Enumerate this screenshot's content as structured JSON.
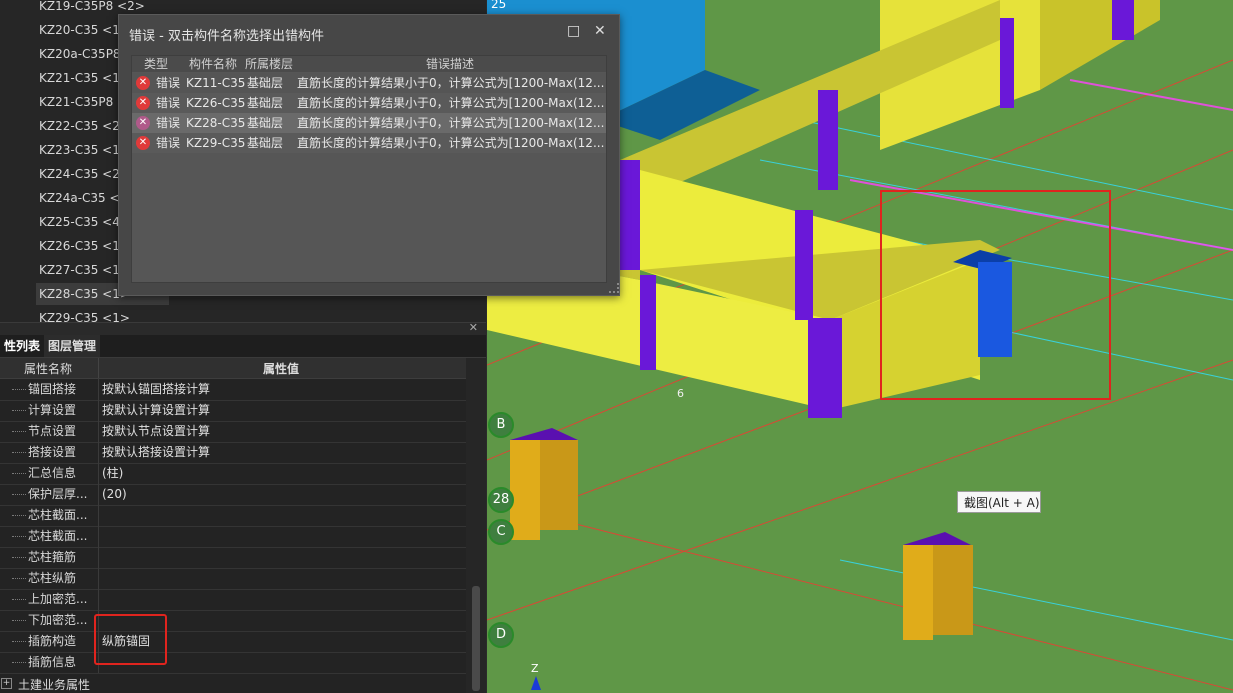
{
  "member_list": [
    {
      "label": "KZ19-C35P8 <2>"
    },
    {
      "label": "KZ20-C35 <1>"
    },
    {
      "label": "KZ20a-C35P8"
    },
    {
      "label": "KZ21-C35 <1"
    },
    {
      "label": "KZ21-C35P8 <"
    },
    {
      "label": "KZ22-C35 <2"
    },
    {
      "label": "KZ23-C35 <1"
    },
    {
      "label": "KZ24-C35 <2"
    },
    {
      "label": "KZ24a-C35 <"
    },
    {
      "label": "KZ25-C35 <4"
    },
    {
      "label": "KZ26-C35 <1"
    },
    {
      "label": "KZ27-C35 <1"
    },
    {
      "label": "KZ28-C35 <1>",
      "selected": true
    },
    {
      "label": "KZ29-C35 <1>"
    }
  ],
  "props_tabs": [
    "性列表",
    "图层管理"
  ],
  "prop_headers": {
    "name": "属性名称",
    "value": "属性值"
  },
  "props": [
    {
      "name": "锚固搭接",
      "value": "按默认锚固搭接计算"
    },
    {
      "name": "计算设置",
      "value": "按默认计算设置计算"
    },
    {
      "name": "节点设置",
      "value": "按默认节点设置计算"
    },
    {
      "name": "搭接设置",
      "value": "按默认搭接设置计算"
    },
    {
      "name": "汇总信息",
      "value": "(柱)"
    },
    {
      "name": "保护层厚...",
      "value": "(20)"
    },
    {
      "name": "芯柱截面...",
      "value": ""
    },
    {
      "name": "芯柱截面...",
      "value": ""
    },
    {
      "name": "芯柱箍筋",
      "value": ""
    },
    {
      "name": "芯柱纵筋",
      "value": ""
    },
    {
      "name": "上加密范...",
      "value": ""
    },
    {
      "name": "下加密范...",
      "value": ""
    },
    {
      "name": "插筋构造",
      "value": "纵筋锚固"
    },
    {
      "name": "插筋信息",
      "value": ""
    }
  ],
  "props_group": {
    "expander": "+",
    "label": "土建业务属性"
  },
  "dialog": {
    "title": "错误 - 双击构件名称选择出错构件",
    "maximize_glyph": "□",
    "close_glyph": "✕",
    "headers": {
      "type": "类型",
      "name": "构件名称",
      "floor": "所属楼层",
      "desc": "错误描述"
    },
    "rows": [
      {
        "type": "错误",
        "name": "KZ11-C35",
        "floor": "基础层",
        "desc": "直筋长度的计算结果小于0，计算公式为[1200-Max(12..."
      },
      {
        "type": "错误",
        "name": "KZ26-C35",
        "floor": "基础层",
        "desc": "直筋长度的计算结果小于0，计算公式为[1200-Max(12..."
      },
      {
        "type": "错误",
        "name": "KZ28-C35",
        "floor": "基础层",
        "desc": "直筋长度的计算结果小于0，计算公式为[1200-Max(12..."
      },
      {
        "type": "错误",
        "name": "KZ29-C35",
        "floor": "基础层",
        "desc": "直筋长度的计算结果小于0，计算公式为[1200-Max(12..."
      }
    ]
  },
  "tooltip": "截图(Alt + A)",
  "axis_labels": [
    "B",
    "28",
    "C",
    "D"
  ],
  "axis_z": "Z",
  "grid_label_top": "25",
  "dimension_label": "6"
}
